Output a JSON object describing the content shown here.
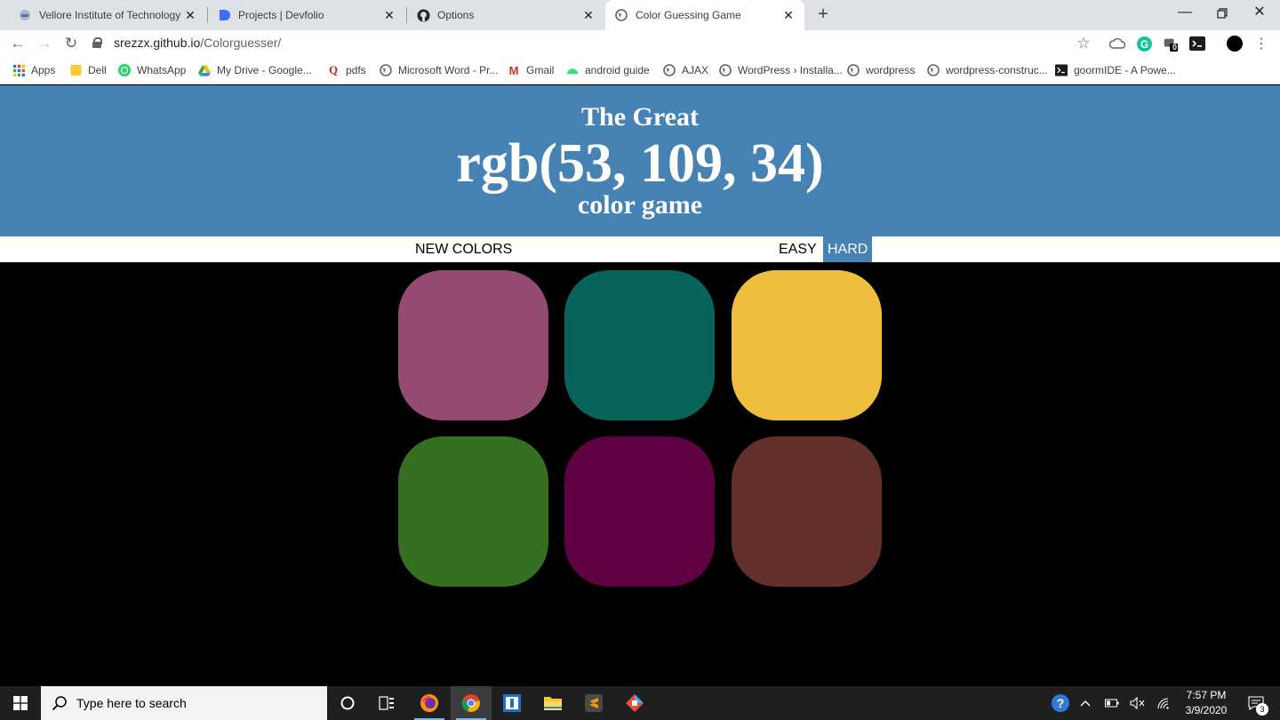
{
  "browser": {
    "tabs": [
      {
        "title": "Vellore Institute of Technology (V",
        "icon": "vit-logo-icon",
        "active": false
      },
      {
        "title": "Projects | Devfolio",
        "icon": "devfolio-icon",
        "active": false
      },
      {
        "title": "Options",
        "icon": "github-icon",
        "active": false
      },
      {
        "title": "Color Guessing Game",
        "icon": "globe-icon",
        "active": true
      }
    ],
    "address": {
      "host": "srezzx.github.io",
      "path": "/Colorguesser/"
    },
    "bookmarks": [
      {
        "label": "Apps",
        "icon": "apps-grid-icon"
      },
      {
        "label": "Dell",
        "icon": "folder-icon"
      },
      {
        "label": "WhatsApp",
        "icon": "whatsapp-icon"
      },
      {
        "label": "My Drive - Google...",
        "icon": "google-drive-icon"
      },
      {
        "label": "pdfs",
        "icon": "quora-icon"
      },
      {
        "label": "Microsoft Word - Pr...",
        "icon": "globe-icon"
      },
      {
        "label": "Gmail",
        "icon": "gmail-icon"
      },
      {
        "label": "android guide",
        "icon": "android-icon"
      },
      {
        "label": "AJAX",
        "icon": "globe-icon"
      },
      {
        "label": "WordPress › Installa...",
        "icon": "globe-icon"
      },
      {
        "label": "wordpress",
        "icon": "globe-icon"
      },
      {
        "label": "wordpress-construc...",
        "icon": "globe-icon"
      },
      {
        "label": "goormIDE - A Powe...",
        "icon": "terminal-icon"
      }
    ],
    "extension_badge": "0"
  },
  "game": {
    "title_line1": "The Great",
    "target_color": "rgb(53, 109, 34)",
    "title_line3": "color game",
    "new_colors_label": "NEW COLORS",
    "message": "",
    "easy_label": "EASY",
    "hard_label": "HARD",
    "selected_mode": "HARD",
    "banner_color": "#4682b4",
    "squares": [
      "#944b72",
      "#08635a",
      "#edbf3d",
      "#357022",
      "#5f0142",
      "#622f2a"
    ]
  },
  "taskbar": {
    "search_placeholder": "Type here to search",
    "time": "7:57 PM",
    "date": "3/9/2020",
    "notification_count": "3"
  }
}
